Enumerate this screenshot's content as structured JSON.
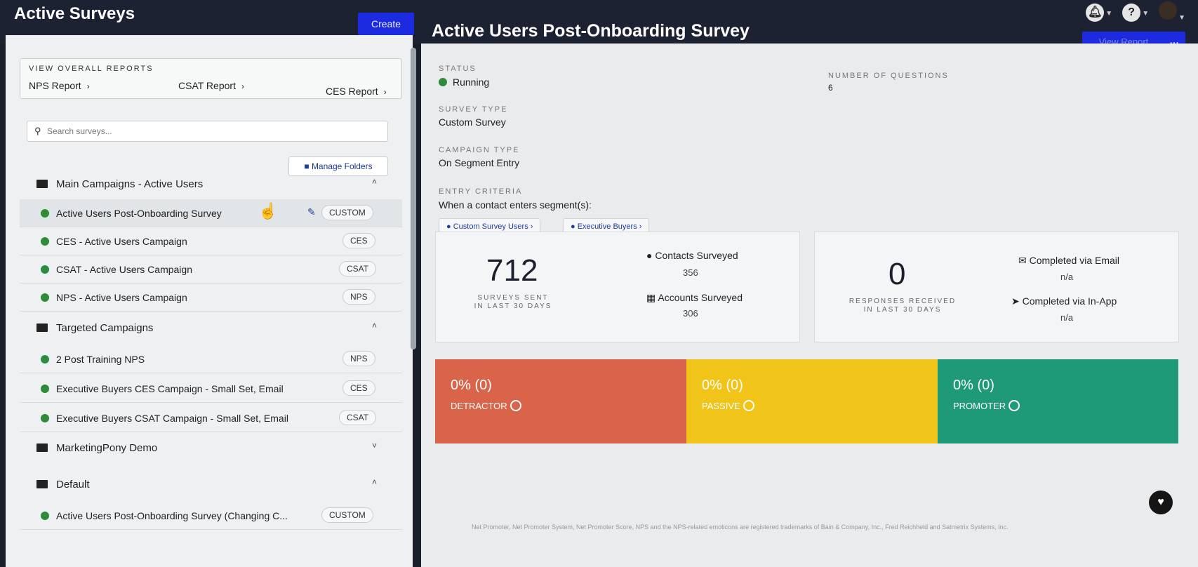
{
  "header": {
    "app_title": "Active Surveys",
    "create_label": "Create",
    "survey_title": "Active Users Post-Onboarding Survey",
    "view_report_label": "View Report",
    "more_label": "..."
  },
  "sidebar": {
    "reports": {
      "heading": "VIEW OVERALL REPORTS",
      "nps_label": "NPS Report",
      "csat_label": "CSAT Report",
      "ces_label": "CES Report"
    },
    "search": {
      "placeholder": "Search surveys..."
    },
    "manage_folders_label": "Manage Folders",
    "folders": {
      "main": "Main Campaigns - Active Users",
      "targeted": "Targeted Campaigns",
      "marketing": "MarketingPony Demo",
      "default": "Default"
    },
    "surveys": [
      {
        "label": "Active Users Post-Onboarding Survey",
        "badge": "CUSTOM"
      },
      {
        "label": "CES - Active Users Campaign",
        "badge": "CES"
      },
      {
        "label": "CSAT - Active Users Campaign",
        "badge": "CSAT"
      },
      {
        "label": "NPS - Active Users Campaign",
        "badge": "NPS"
      },
      {
        "label": "2 Post Training NPS",
        "badge": "NPS"
      },
      {
        "label": "Executive Buyers CES Campaign - Small Set, Email",
        "badge": "CES"
      },
      {
        "label": "Executive Buyers CSAT Campaign - Small Set, Email",
        "badge": "CSAT"
      },
      {
        "label": "Active Users Post-Onboarding Survey (Changing C...",
        "badge": "CUSTOM"
      }
    ]
  },
  "details": {
    "status_label": "STATUS",
    "status_value": "Running",
    "num_questions_label": "NUMBER OF QUESTIONS",
    "num_questions_value": "6",
    "survey_type_label": "SURVEY TYPE",
    "survey_type_value": "Custom Survey",
    "campaign_type_label": "CAMPAIGN TYPE",
    "campaign_type_value": "On Segment Entry",
    "entry_criteria_label": "ENTRY CRITERIA",
    "entry_criteria_value": "When a contact enters segment(s):",
    "segments": [
      "Custom Survey Users",
      "Executive Buyers"
    ]
  },
  "stats": {
    "surveys_sent": "712",
    "surveys_sent_label_1": "SURVEYS SENT",
    "surveys_sent_label_2": "IN LAST 30 DAYS",
    "contacts_surveyed_label": "Contacts Surveyed",
    "contacts_surveyed_value": "356",
    "accounts_surveyed_label": "Accounts Surveyed",
    "accounts_surveyed_value": "306",
    "responses": "0",
    "responses_label_1": "RESPONSES RECEIVED",
    "responses_label_2": "IN LAST 30 DAYS",
    "completed_email_label": "Completed via Email",
    "completed_email_value": "n/a",
    "completed_inapp_label": "Completed via In-App",
    "completed_inapp_value": "n/a"
  },
  "nps": {
    "detractor": {
      "value": "0% (0)",
      "label": "DETRACTOR",
      "color": "#d9644a"
    },
    "passive": {
      "value": "0% (0)",
      "label": "PASSIVE",
      "color": "#f0c419"
    },
    "promoter": {
      "value": "0% (0)",
      "label": "PROMOTER",
      "color": "#1f9a78"
    }
  },
  "footer": {
    "trademark": "Net Promoter, Net Promoter System, Net Promoter Score, NPS and the NPS-related emoticons are registered trademarks of Bain & Company, Inc., Fred Reichheld and Satmetrix Systems, Inc."
  }
}
